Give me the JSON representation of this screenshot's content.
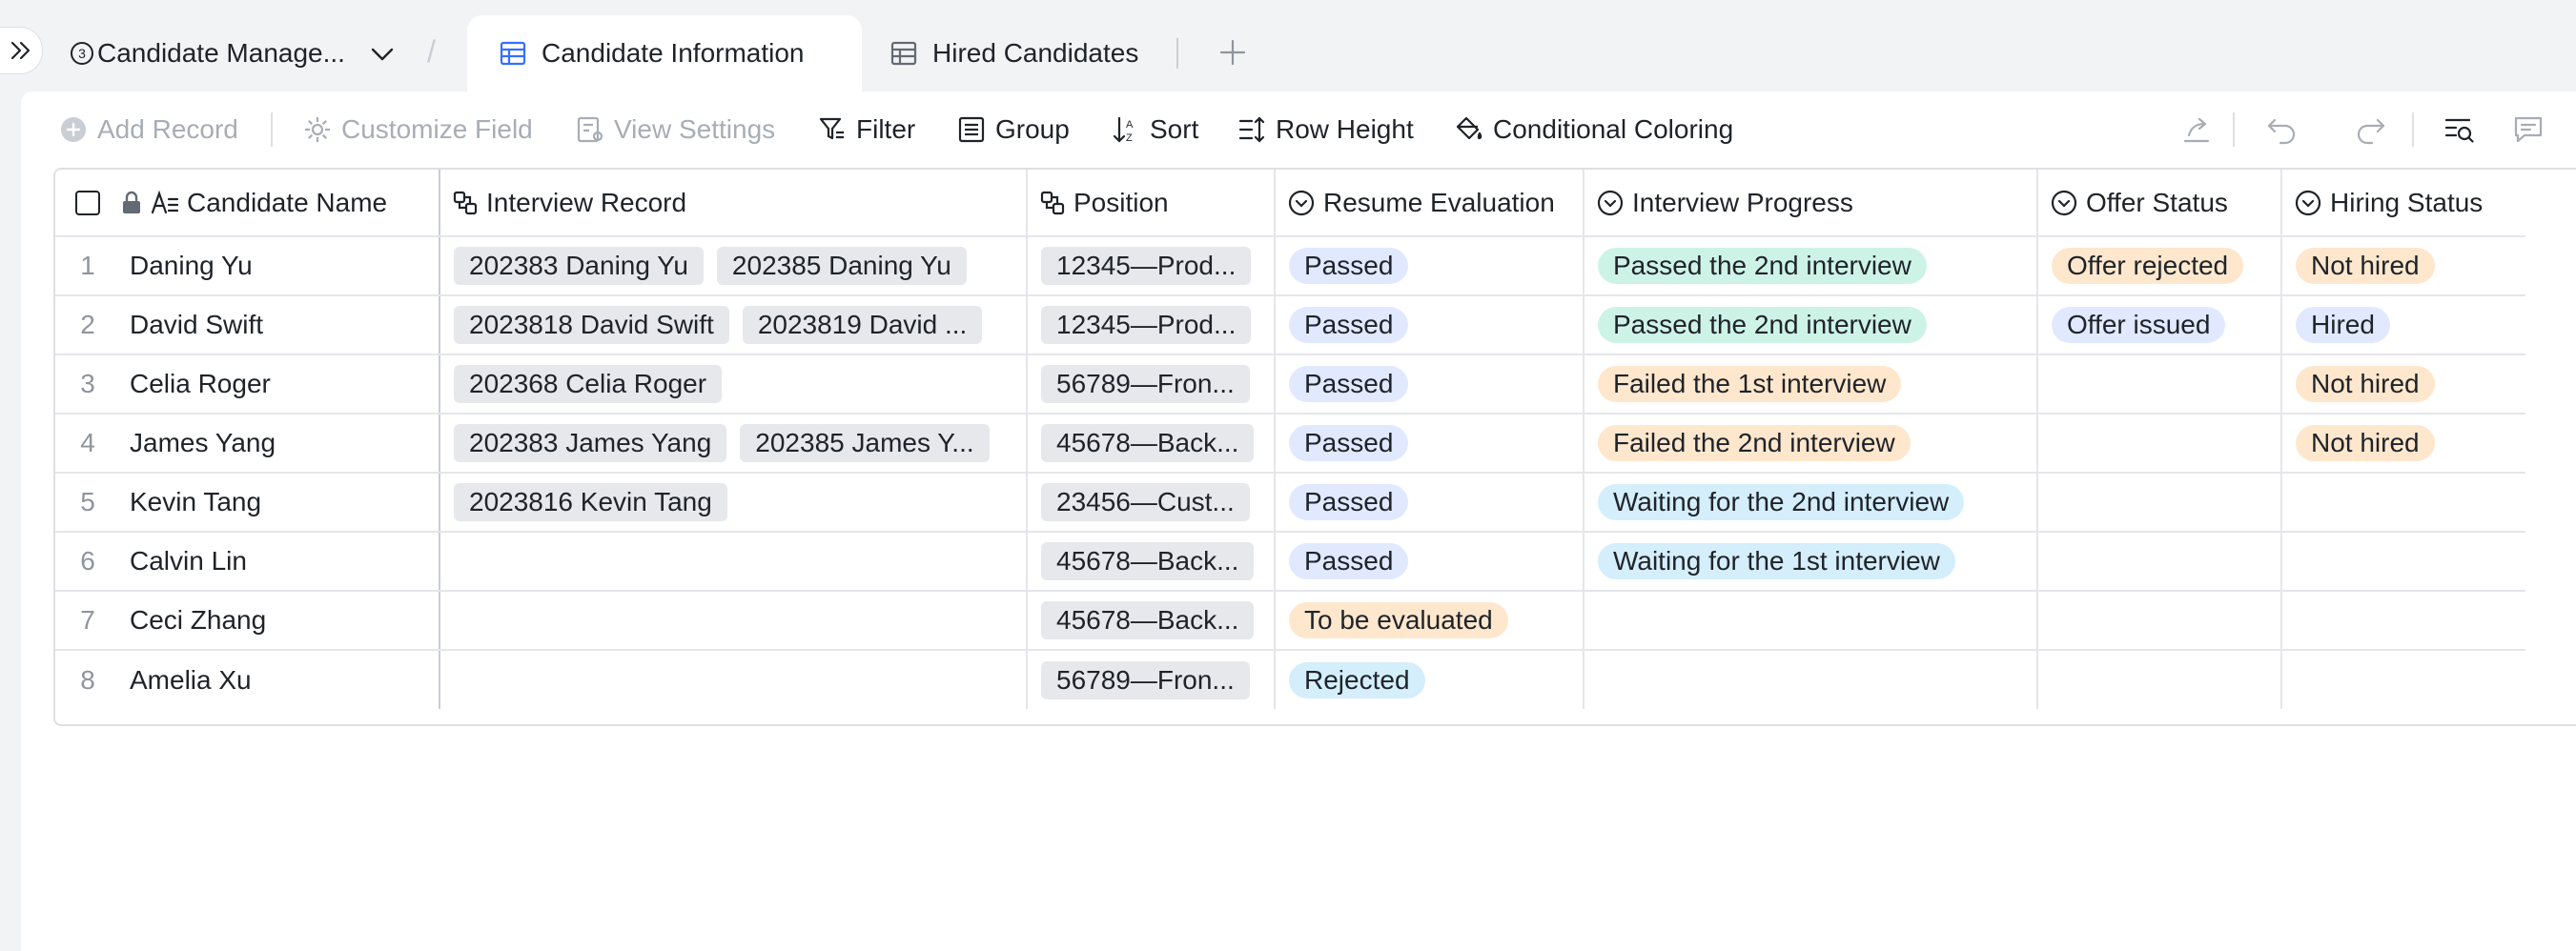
{
  "topbar": {
    "base_number": "3",
    "base_title": "Candidate Manage...",
    "tabs": [
      {
        "label": "Candidate Information"
      },
      {
        "label": "Hired Candidates"
      }
    ]
  },
  "toolbar": {
    "add_record": "Add Record",
    "customize_field": "Customize Field",
    "view_settings": "View Settings",
    "filter": "Filter",
    "group": "Group",
    "sort": "Sort",
    "row_height": "Row Height",
    "conditional_coloring": "Conditional Coloring"
  },
  "table": {
    "headers": {
      "name": "Candidate Name",
      "interview_record": "Interview Record",
      "position": "Position",
      "resume_evaluation": "Resume Evaluation",
      "interview_progress": "Interview Progress",
      "offer_status": "Offer Status",
      "hiring_status": "Hiring Status"
    },
    "rows": [
      {
        "num": "1",
        "name": "Daning Yu",
        "r1": "202383 Daning Yu",
        "r2": "202385 Daning Yu",
        "position": "12345—Prod...",
        "resume": "Passed",
        "progress": "Passed the 2nd interview",
        "offer": "Offer rejected",
        "hiring": "Not hired"
      },
      {
        "num": "2",
        "name": "David Swift",
        "r1": "2023818 David Swift",
        "r2": "2023819 David ...",
        "position": "12345—Prod...",
        "resume": "Passed",
        "progress": "Passed the 2nd interview",
        "offer": "Offer issued",
        "hiring": "Hired"
      },
      {
        "num": "3",
        "name": "Celia Roger",
        "r1": "202368 Celia Roger",
        "r2": "",
        "position": "56789—Fron...",
        "resume": "Passed",
        "progress": "Failed the 1st interview",
        "offer": "",
        "hiring": "Not hired"
      },
      {
        "num": "4",
        "name": "James Yang",
        "r1": "202383 James Yang",
        "r2": "202385 James Y...",
        "position": "45678—Back...",
        "resume": "Passed",
        "progress": "Failed the 2nd interview",
        "offer": "",
        "hiring": "Not hired"
      },
      {
        "num": "5",
        "name": "Kevin Tang",
        "r1": "2023816 Kevin Tang",
        "r2": "",
        "position": "23456—Cust...",
        "resume": "Passed",
        "progress": "Waiting for the 2nd interview",
        "offer": "",
        "hiring": ""
      },
      {
        "num": "6",
        "name": "Calvin Lin",
        "r1": "",
        "r2": "",
        "position": "45678—Back...",
        "resume": "Passed",
        "progress": "Waiting for the 1st interview",
        "offer": "",
        "hiring": ""
      },
      {
        "num": "7",
        "name": "Ceci Zhang",
        "r1": "",
        "r2": "",
        "position": "45678—Back...",
        "resume": "To be evaluated",
        "progress": "",
        "offer": "",
        "hiring": ""
      },
      {
        "num": "8",
        "name": "Amelia Xu",
        "r1": "",
        "r2": "",
        "position": "56789—Fron...",
        "resume": "Rejected",
        "progress": "",
        "offer": "",
        "hiring": ""
      }
    ]
  },
  "colors": {
    "pill_blue": "#e0e9ff",
    "pill_teal": "#cdf3e7",
    "pill_orange": "#fee7cd",
    "pill_sky": "#d4eefb",
    "tab_icon_blue": "#3370ff"
  }
}
